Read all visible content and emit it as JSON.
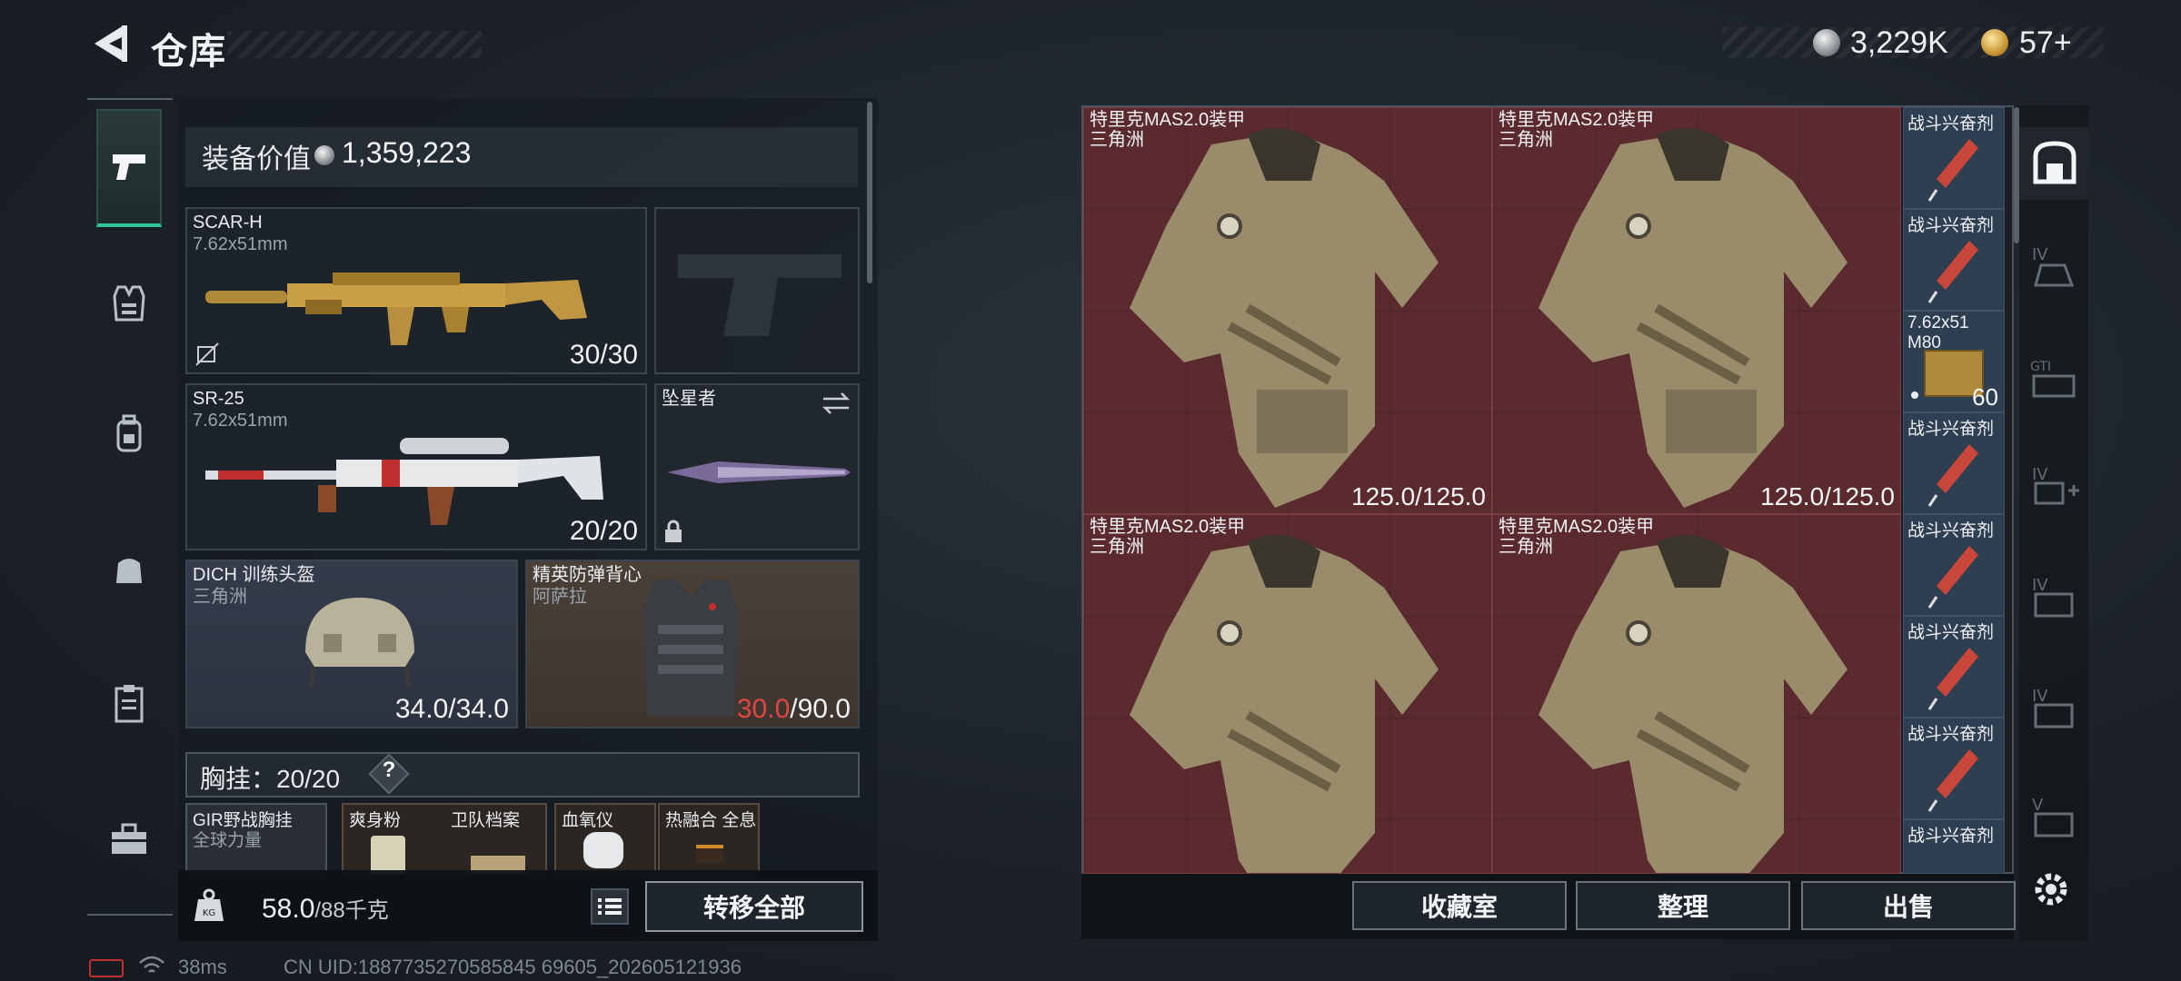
{
  "header": {
    "title": "仓库",
    "currency_silver": "3,229K",
    "currency_gold": "57+"
  },
  "equipment": {
    "value_label": "装备价值",
    "value_amount": "1,359,223",
    "primary": {
      "name": "SCAR-H",
      "caliber": "7.62x51mm",
      "ammo": "30/30"
    },
    "secondary": {
      "name": "SR-25",
      "caliber": "7.62x51mm",
      "ammo": "20/20"
    },
    "melee": {
      "name": "坠星者"
    },
    "helmet": {
      "name": "DICH 训练头盔",
      "sub": "三角洲",
      "durability": "34.0/34.0"
    },
    "vest": {
      "name": "精英防弹背心",
      "sub": "阿萨拉",
      "durability_current": "30.0",
      "durability_max": "/90.0"
    },
    "chest_label": "胸挂：",
    "chest_value": "20/20",
    "help": "?",
    "chest_items": [
      {
        "name": "GIR野战胸挂",
        "sub": "全球力量"
      },
      {
        "name": "爽身粉"
      },
      {
        "name": "卫队档案"
      },
      {
        "name": "血氧仪"
      },
      {
        "name": "热融合 全息"
      }
    ],
    "weight_current": "58.0",
    "weight_max": "/88千克",
    "transfer_all": "转移全部"
  },
  "stash": {
    "armors": [
      {
        "name": "特里克MAS2.0装甲",
        "sub": "三角洲",
        "durability": "125.0/125.0"
      },
      {
        "name": "特里克MAS2.0装甲",
        "sub": "三角洲",
        "durability": "125.0/125.0"
      },
      {
        "name": "特里克MAS2.0装甲",
        "sub": "三角洲"
      },
      {
        "name": "特里克MAS2.0装甲",
        "sub": "三角洲"
      }
    ],
    "side_items": [
      {
        "name": "战斗兴奋剂"
      },
      {
        "name": "战斗兴奋剂"
      },
      {
        "name": "7.62x51",
        "sub": "M80",
        "qty": "60"
      },
      {
        "name": "战斗兴奋剂"
      },
      {
        "name": "战斗兴奋剂"
      },
      {
        "name": "战斗兴奋剂"
      },
      {
        "name": "战斗兴奋剂"
      },
      {
        "name": "战斗兴奋剂"
      }
    ],
    "buttons": {
      "collection": "收藏室",
      "organize": "整理",
      "sell": "出售"
    }
  },
  "status": {
    "ping": "38ms",
    "uid": "CN UID:1887735270585845 69605_202605121936"
  },
  "colors": {
    "accent_green": "#2fc59a",
    "durability_low": "#e04545",
    "armor_bg": "#5a2a2e",
    "ammo_bg": "#2e3f52"
  },
  "icons": [
    "back-arrow-icon",
    "silver-coin-icon",
    "gold-coin-icon",
    "pistol-icon",
    "vest-icon",
    "backpack-icon",
    "bag-icon",
    "clipboard-icon",
    "toolbox-icon",
    "weight-icon",
    "list-icon",
    "safe-icon",
    "settings-icon",
    "swap-icon",
    "lock-icon"
  ]
}
